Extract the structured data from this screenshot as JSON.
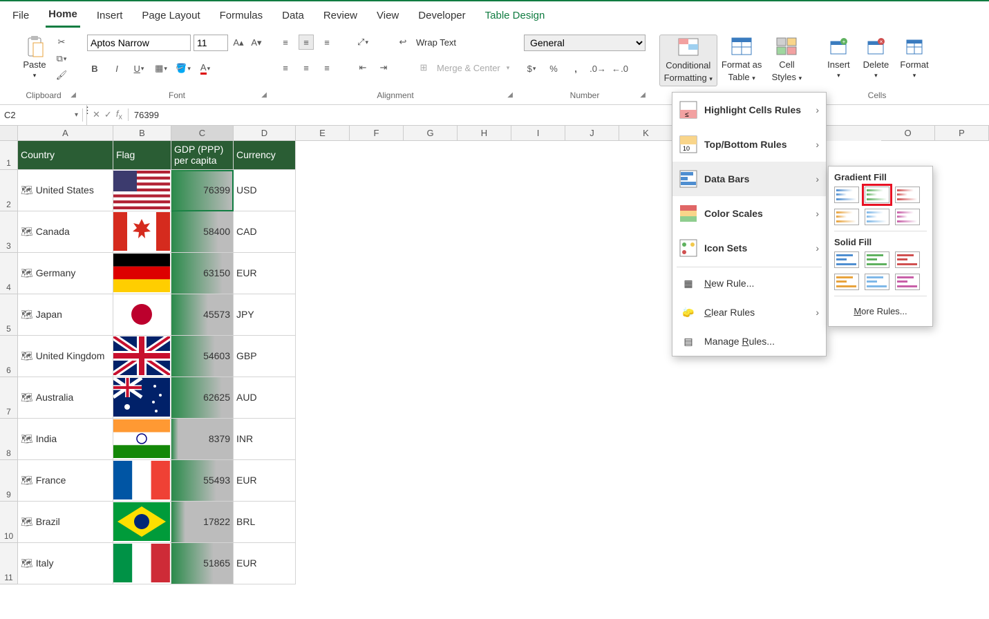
{
  "tabs": {
    "file": "File",
    "home": "Home",
    "insert": "Insert",
    "pagelayout": "Page Layout",
    "formulas": "Formulas",
    "data": "Data",
    "review": "Review",
    "view": "View",
    "developer": "Developer",
    "tabledesign": "Table Design"
  },
  "ribbon": {
    "paste": "Paste",
    "clipboard": "Clipboard",
    "font_name": "Aptos Narrow",
    "font_size": "11",
    "font_group": "Font",
    "wrap": "Wrap Text",
    "merge": "Merge & Center",
    "align_group": "Alignment",
    "num_format": "General",
    "num_group": "Number",
    "cf": "Conditional",
    "cf2": "Formatting",
    "fmt_as": "Format as",
    "fmt_as2": "Table",
    "cellstyles": "Cell",
    "cellstyles2": "Styles",
    "insert": "Insert",
    "delete": "Delete",
    "format": "Format",
    "cells_group": "Cells"
  },
  "namebox": "C2",
  "formula": "76399",
  "cols": [
    "A",
    "B",
    "C",
    "D",
    "E",
    "F",
    "G",
    "H",
    "I",
    "J",
    "K",
    "O",
    "P"
  ],
  "headers": {
    "country": "Country",
    "flag": "Flag",
    "gdp": "GDP (PPP) per capita",
    "cur": "Currency"
  },
  "rows": [
    {
      "n": "2",
      "country": "United States",
      "gdp": "76399",
      "cur": "USD",
      "bar": 100,
      "flag": "us"
    },
    {
      "n": "3",
      "country": "Canada",
      "gdp": "58400",
      "cur": "CAD",
      "bar": 76,
      "flag": "ca"
    },
    {
      "n": "4",
      "country": "Germany",
      "gdp": "63150",
      "cur": "EUR",
      "bar": 83,
      "flag": "de"
    },
    {
      "n": "5",
      "country": "Japan",
      "gdp": "45573",
      "cur": "JPY",
      "bar": 60,
      "flag": "jp"
    },
    {
      "n": "6",
      "country": "United Kingdom",
      "gdp": "54603",
      "cur": "GBP",
      "bar": 71,
      "flag": "uk"
    },
    {
      "n": "7",
      "country": "Australia",
      "gdp": "62625",
      "cur": "AUD",
      "bar": 82,
      "flag": "au"
    },
    {
      "n": "8",
      "country": "India",
      "gdp": "8379",
      "cur": "INR",
      "bar": 11,
      "flag": "in"
    },
    {
      "n": "9",
      "country": "France",
      "gdp": "55493",
      "cur": "EUR",
      "bar": 73,
      "flag": "fr"
    },
    {
      "n": "10",
      "country": "Brazil",
      "gdp": "17822",
      "cur": "BRL",
      "bar": 23,
      "flag": "br"
    },
    {
      "n": "11",
      "country": "Italy",
      "gdp": "51865",
      "cur": "EUR",
      "bar": 68,
      "flag": "it"
    }
  ],
  "cfmenu": {
    "highlight": "Highlight Cells Rules",
    "topbottom": "Top/Bottom Rules",
    "databars": "Data Bars",
    "colorscales": "Color Scales",
    "iconsets": "Icon Sets",
    "new": "New Rule...",
    "clear": "Clear Rules",
    "manage": "Manage Rules..."
  },
  "databars_fly": {
    "gf": "Gradient Fill",
    "sf": "Solid Fill",
    "more": "More Rules..."
  }
}
